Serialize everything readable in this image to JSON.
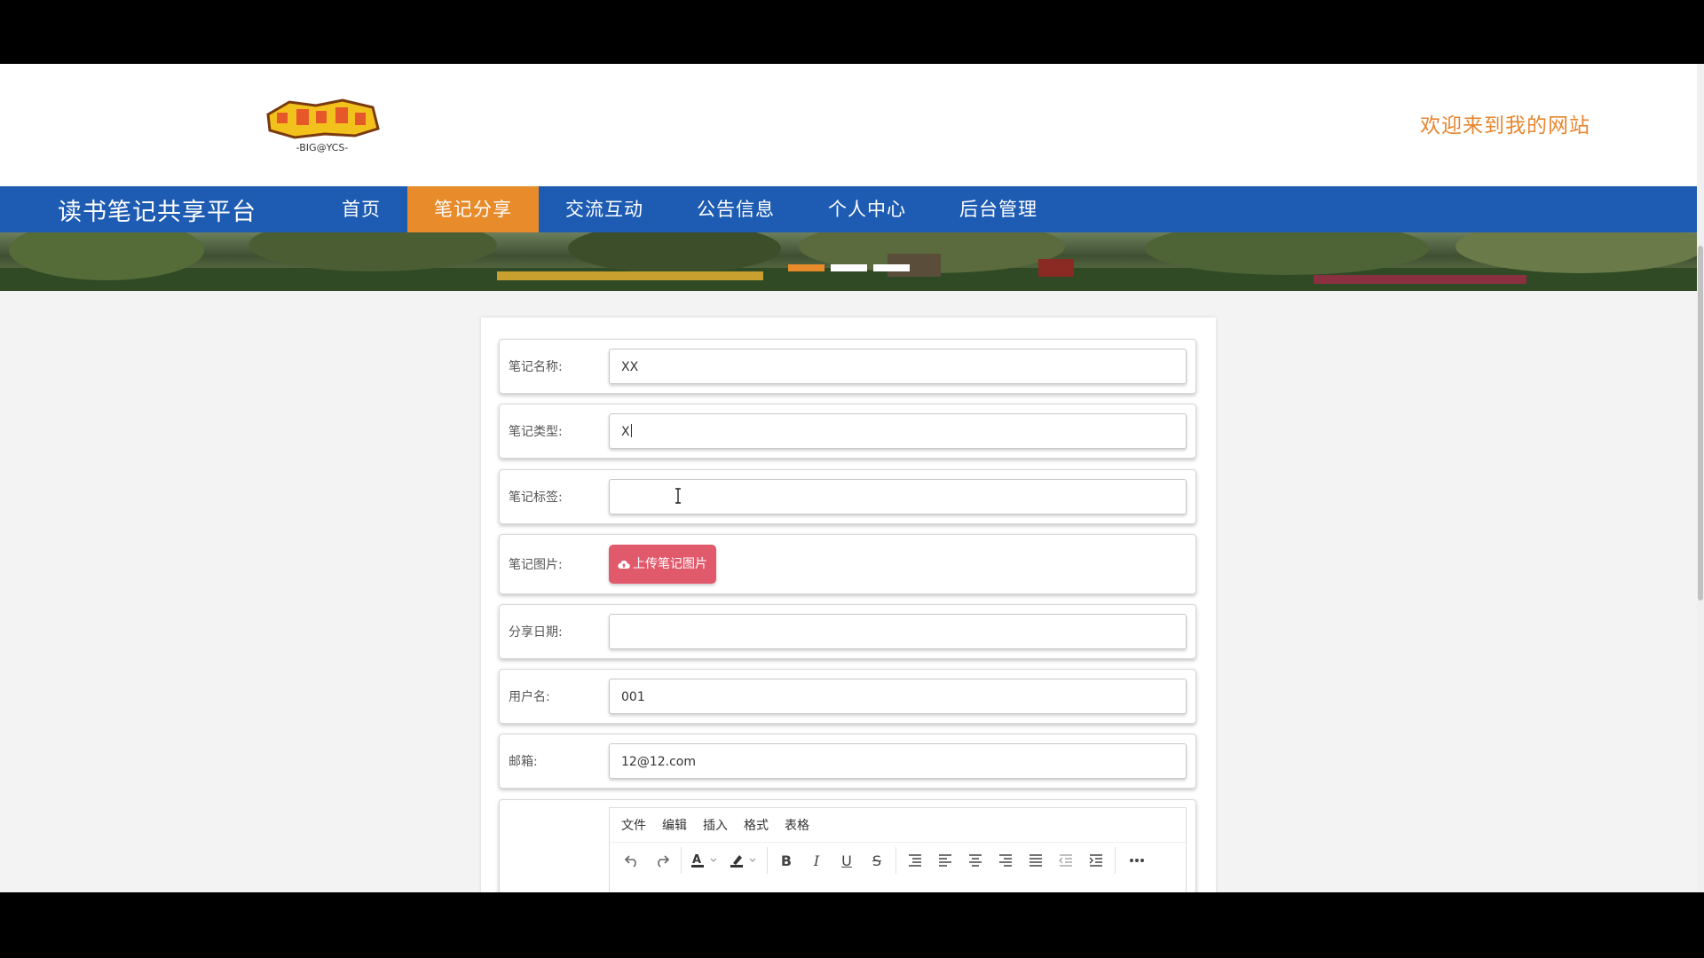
{
  "header": {
    "logo_text": "-BIG@YCS-",
    "welcome": "欢迎来到我的网站"
  },
  "nav": {
    "brand": "读书笔记共享平台",
    "items": [
      {
        "label": "首页",
        "active": false
      },
      {
        "label": "笔记分享",
        "active": true
      },
      {
        "label": "交流互动",
        "active": false
      },
      {
        "label": "公告信息",
        "active": false
      },
      {
        "label": "个人中心",
        "active": false
      },
      {
        "label": "后台管理",
        "active": false
      }
    ]
  },
  "banner": {
    "slides_count": 3,
    "active_slide": 1
  },
  "form": {
    "note_name": {
      "label": "笔记名称:",
      "value": "XX"
    },
    "note_type": {
      "label": "笔记类型:",
      "value": "X"
    },
    "note_tags": {
      "label": "笔记标签:",
      "value": ""
    },
    "note_image": {
      "label": "笔记图片:",
      "button": "上传笔记图片"
    },
    "share_date": {
      "label": "分享日期:",
      "value": ""
    },
    "username": {
      "label": "用户名:",
      "value": "001"
    },
    "email": {
      "label": "邮箱:",
      "value": "12@12.com"
    }
  },
  "editor": {
    "menus": [
      "文件",
      "编辑",
      "插入",
      "格式",
      "表格"
    ],
    "toolbar_icons": [
      "undo-icon",
      "redo-icon",
      "text-color-icon",
      "highlight-icon",
      "bold-icon",
      "italic-icon",
      "underline-icon",
      "strikethrough-icon",
      "line-height-icon",
      "align-left-icon",
      "align-center-icon",
      "align-right-icon",
      "justify-icon",
      "outdent-icon",
      "indent-icon",
      "more-icon"
    ]
  },
  "colors": {
    "nav_bg": "#1e5cb3",
    "accent": "#e88b2a",
    "upload_button": "#e15a6c"
  }
}
